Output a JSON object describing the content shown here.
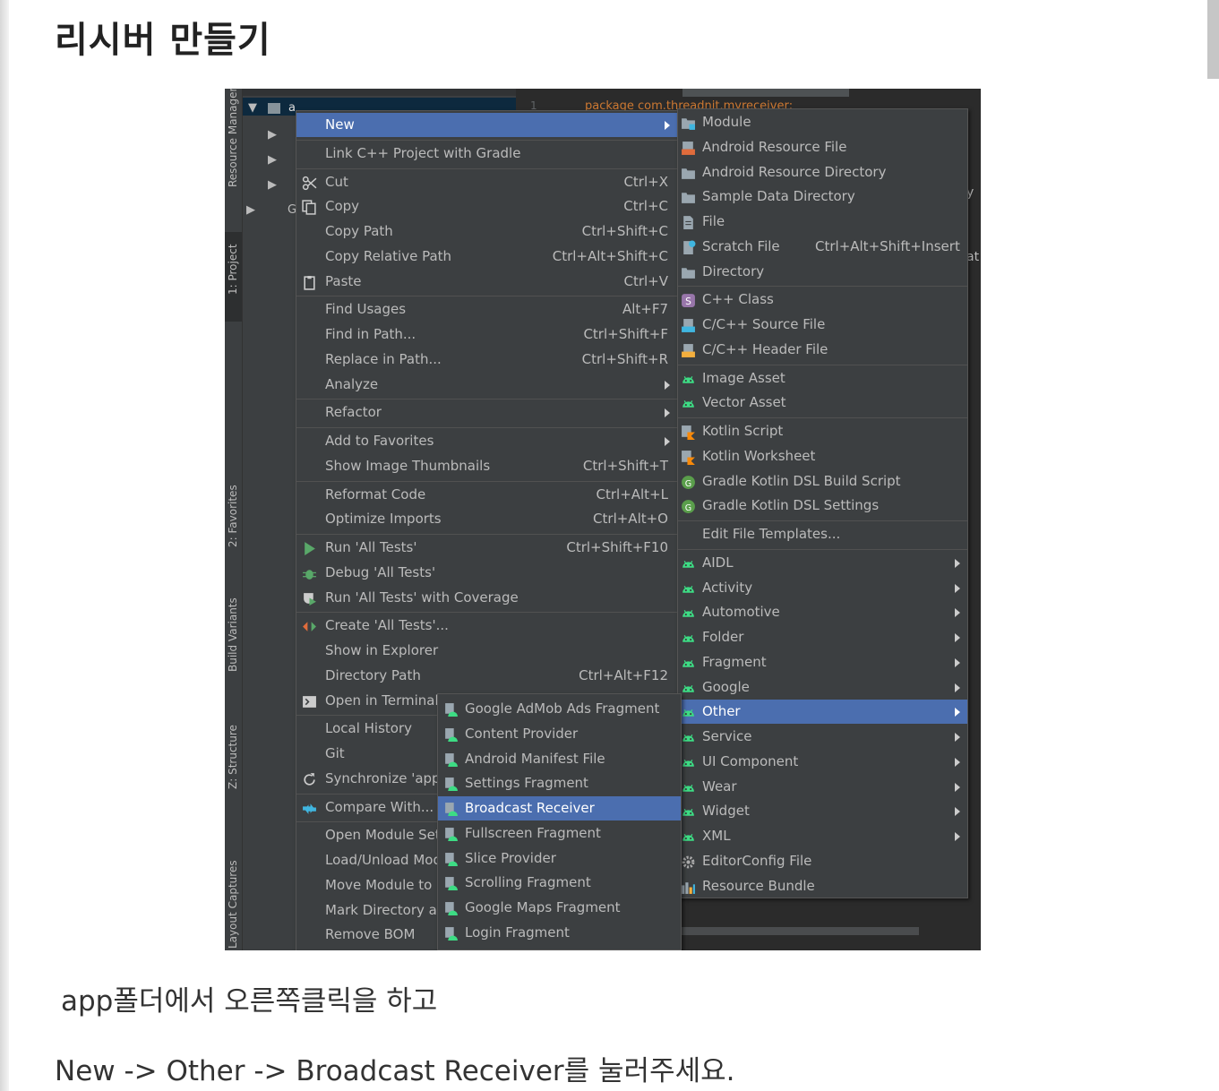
{
  "page": {
    "title": "리시버 만들기",
    "para1": "app폴더에서 오른쪽클릭을 하고",
    "para2": "New -> Other -> Broadcast Receiver를 눌러주세요."
  },
  "ide": {
    "side_tabs": [
      "Resource Manager",
      "1: Project",
      "2: Favorites",
      "Build Variants",
      "Z: Structure",
      "Layout Captures"
    ],
    "tree_root_label": "a",
    "tree_gradle_label": "G",
    "line_number": "1",
    "code_line": "package com.threadnit.myreceiver;",
    "code_fragment_1": "y",
    "code_fragment_2": "at"
  },
  "context_menu": {
    "items": [
      {
        "label": "New",
        "shortcut": "",
        "submenu": true,
        "icon": "",
        "selected": true
      },
      {
        "label": "Link C++ Project with Gradle",
        "shortcut": "",
        "submenu": false,
        "icon": ""
      },
      {
        "label": "Cut",
        "shortcut": "Ctrl+X",
        "submenu": false,
        "icon": "scissors-icon"
      },
      {
        "label": "Copy",
        "shortcut": "Ctrl+C",
        "submenu": false,
        "icon": "copy-icon"
      },
      {
        "label": "Copy Path",
        "shortcut": "Ctrl+Shift+C",
        "submenu": false,
        "icon": ""
      },
      {
        "label": "Copy Relative Path",
        "shortcut": "Ctrl+Alt+Shift+C",
        "submenu": false,
        "icon": ""
      },
      {
        "label": "Paste",
        "shortcut": "Ctrl+V",
        "submenu": false,
        "icon": "clipboard-icon"
      },
      {
        "label": "Find Usages",
        "shortcut": "Alt+F7",
        "submenu": false,
        "icon": ""
      },
      {
        "label": "Find in Path...",
        "shortcut": "Ctrl+Shift+F",
        "submenu": false,
        "icon": ""
      },
      {
        "label": "Replace in Path...",
        "shortcut": "Ctrl+Shift+R",
        "submenu": false,
        "icon": ""
      },
      {
        "label": "Analyze",
        "shortcut": "",
        "submenu": true,
        "icon": ""
      },
      {
        "label": "Refactor",
        "shortcut": "",
        "submenu": true,
        "icon": ""
      },
      {
        "label": "Add to Favorites",
        "shortcut": "",
        "submenu": true,
        "icon": ""
      },
      {
        "label": "Show Image Thumbnails",
        "shortcut": "Ctrl+Shift+T",
        "submenu": false,
        "icon": ""
      },
      {
        "label": "Reformat Code",
        "shortcut": "Ctrl+Alt+L",
        "submenu": false,
        "icon": ""
      },
      {
        "label": "Optimize Imports",
        "shortcut": "Ctrl+Alt+O",
        "submenu": false,
        "icon": ""
      },
      {
        "label": "Run 'All Tests'",
        "shortcut": "Ctrl+Shift+F10",
        "submenu": false,
        "icon": "run-icon"
      },
      {
        "label": "Debug 'All Tests'",
        "shortcut": "",
        "submenu": false,
        "icon": "debug-icon"
      },
      {
        "label": "Run 'All Tests' with Coverage",
        "shortcut": "",
        "submenu": false,
        "icon": "coverage-icon"
      },
      {
        "label": "Create 'All Tests'...",
        "shortcut": "",
        "submenu": false,
        "icon": "create-test-icon"
      },
      {
        "label": "Show in Explorer",
        "shortcut": "",
        "submenu": false,
        "icon": ""
      },
      {
        "label": "Directory Path",
        "shortcut": "Ctrl+Alt+F12",
        "submenu": false,
        "icon": ""
      },
      {
        "label": "Open in Terminal",
        "shortcut": "",
        "submenu": false,
        "icon": "terminal-icon"
      },
      {
        "label": "Local History",
        "shortcut": "",
        "submenu": false,
        "icon": ""
      },
      {
        "label": "Git",
        "shortcut": "",
        "submenu": false,
        "icon": ""
      },
      {
        "label": "Synchronize 'app'",
        "shortcut": "",
        "submenu": false,
        "icon": "sync-icon"
      },
      {
        "label": "Compare With...",
        "shortcut": "",
        "submenu": false,
        "icon": "compare-icon"
      },
      {
        "label": "Open Module Set",
        "shortcut": "",
        "submenu": false,
        "icon": ""
      },
      {
        "label": "Load/Unload Mod",
        "shortcut": "",
        "submenu": false,
        "icon": ""
      },
      {
        "label": "Move Module to",
        "shortcut": "",
        "submenu": false,
        "icon": ""
      },
      {
        "label": "Mark Directory as",
        "shortcut": "",
        "submenu": false,
        "icon": ""
      },
      {
        "label": "Remove BOM",
        "shortcut": "",
        "submenu": false,
        "icon": ""
      }
    ]
  },
  "new_menu": {
    "items": [
      {
        "label": "Module",
        "shortcut": "",
        "submenu": false,
        "icon": "module-icon"
      },
      {
        "label": "Android Resource File",
        "shortcut": "",
        "submenu": false,
        "icon": "resource-file-icon"
      },
      {
        "label": "Android Resource Directory",
        "shortcut": "",
        "submenu": false,
        "icon": "folder-icon"
      },
      {
        "label": "Sample Data Directory",
        "shortcut": "",
        "submenu": false,
        "icon": "folder-icon"
      },
      {
        "label": "File",
        "shortcut": "",
        "submenu": false,
        "icon": "file-icon"
      },
      {
        "label": "Scratch File",
        "shortcut": "Ctrl+Alt+Shift+Insert",
        "submenu": false,
        "icon": "scratch-file-icon"
      },
      {
        "label": "Directory",
        "shortcut": "",
        "submenu": false,
        "icon": "folder-icon"
      },
      {
        "label": "C++ Class",
        "shortcut": "",
        "submenu": false,
        "icon": "cpp-class-icon"
      },
      {
        "label": "C/C++ Source File",
        "shortcut": "",
        "submenu": false,
        "icon": "cpp-source-icon"
      },
      {
        "label": "C/C++ Header File",
        "shortcut": "",
        "submenu": false,
        "icon": "cpp-header-icon"
      },
      {
        "label": "Image Asset",
        "shortcut": "",
        "submenu": false,
        "icon": "android-icon"
      },
      {
        "label": "Vector Asset",
        "shortcut": "",
        "submenu": false,
        "icon": "android-icon"
      },
      {
        "label": "Kotlin Script",
        "shortcut": "",
        "submenu": false,
        "icon": "kotlin-icon"
      },
      {
        "label": "Kotlin Worksheet",
        "shortcut": "",
        "submenu": false,
        "icon": "kotlin-icon"
      },
      {
        "label": "Gradle Kotlin DSL Build Script",
        "shortcut": "",
        "submenu": false,
        "icon": "gradle-icon"
      },
      {
        "label": "Gradle Kotlin DSL Settings",
        "shortcut": "",
        "submenu": false,
        "icon": "gradle-icon"
      },
      {
        "label": "Edit File Templates...",
        "shortcut": "",
        "submenu": false,
        "icon": ""
      },
      {
        "label": "AIDL",
        "shortcut": "",
        "submenu": true,
        "icon": "android-icon"
      },
      {
        "label": "Activity",
        "shortcut": "",
        "submenu": true,
        "icon": "android-icon"
      },
      {
        "label": "Automotive",
        "shortcut": "",
        "submenu": true,
        "icon": "android-icon"
      },
      {
        "label": "Folder",
        "shortcut": "",
        "submenu": true,
        "icon": "android-icon"
      },
      {
        "label": "Fragment",
        "shortcut": "",
        "submenu": true,
        "icon": "android-icon"
      },
      {
        "label": "Google",
        "shortcut": "",
        "submenu": true,
        "icon": "android-icon"
      },
      {
        "label": "Other",
        "shortcut": "",
        "submenu": true,
        "icon": "android-icon",
        "selected": true
      },
      {
        "label": "Service",
        "shortcut": "",
        "submenu": true,
        "icon": "android-icon"
      },
      {
        "label": "UI Component",
        "shortcut": "",
        "submenu": true,
        "icon": "android-icon"
      },
      {
        "label": "Wear",
        "shortcut": "",
        "submenu": true,
        "icon": "android-icon"
      },
      {
        "label": "Widget",
        "shortcut": "",
        "submenu": true,
        "icon": "android-icon"
      },
      {
        "label": "XML",
        "shortcut": "",
        "submenu": true,
        "icon": "android-icon"
      },
      {
        "label": "EditorConfig File",
        "shortcut": "",
        "submenu": false,
        "icon": "gear-icon"
      },
      {
        "label": "Resource Bundle",
        "shortcut": "",
        "submenu": false,
        "icon": "bundle-icon"
      }
    ]
  },
  "other_menu": {
    "items": [
      {
        "label": "Google AdMob Ads Fragment",
        "icon": "template-icon"
      },
      {
        "label": "Content Provider",
        "icon": "template-icon"
      },
      {
        "label": "Android Manifest File",
        "icon": "template-icon"
      },
      {
        "label": "Settings Fragment",
        "icon": "template-icon"
      },
      {
        "label": "Broadcast Receiver",
        "icon": "template-icon",
        "selected": true
      },
      {
        "label": "Fullscreen Fragment",
        "icon": "template-icon"
      },
      {
        "label": "Slice Provider",
        "icon": "template-icon"
      },
      {
        "label": "Scrolling Fragment",
        "icon": "template-icon"
      },
      {
        "label": "Google Maps Fragment",
        "icon": "template-icon"
      },
      {
        "label": "Login Fragment",
        "icon": "template-icon"
      }
    ]
  },
  "colors": {
    "menu_bg": "#3c3f41",
    "selection": "#4b6eaf",
    "android_green": "#3ddc84",
    "text": "#bbbbbb"
  }
}
